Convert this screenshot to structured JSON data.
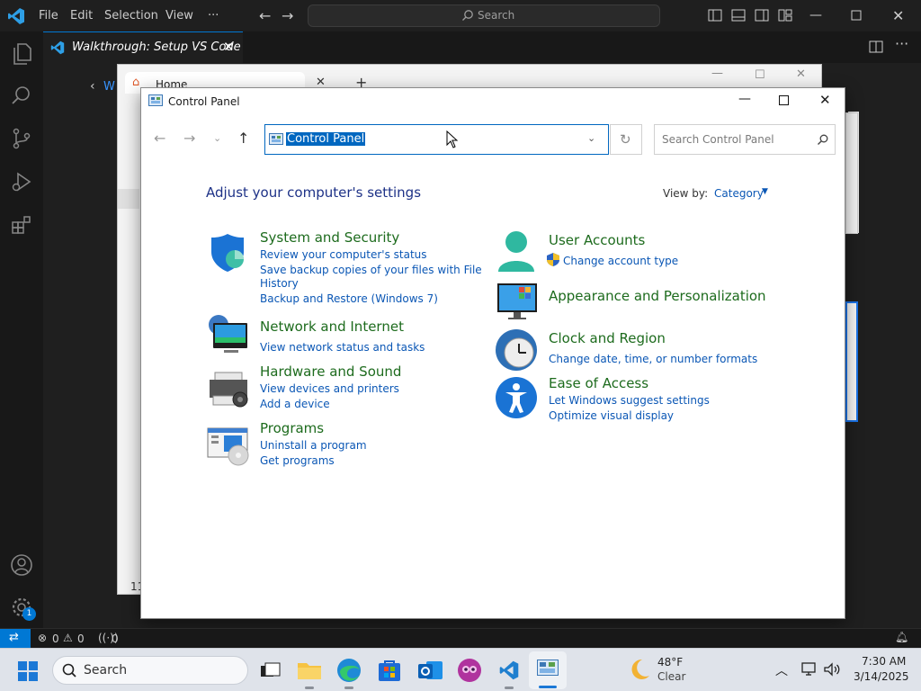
{
  "vscode": {
    "menu": [
      "File",
      "Edit",
      "Selection",
      "View",
      "···"
    ],
    "command_center_placeholder": "Search",
    "tab_title": "Walkthrough: Setup VS Code",
    "back_label": "W",
    "status": {
      "errors": "0",
      "warnings": "0",
      "ports": "0"
    },
    "accounts_badge": "1",
    "bg_side_text": "11"
  },
  "browser": {
    "tab_title": "Home",
    "new_tab": "+"
  },
  "control_panel": {
    "window_title": "Control Panel",
    "address_text": "Control Panel",
    "search_placeholder": "Search Control Panel",
    "heading": "Adjust your computer's settings",
    "view_by_label": "View by:",
    "view_by_value": "Category",
    "categories_left": [
      {
        "title": "System and Security",
        "links": [
          "Review your computer's status",
          "Save backup copies of your files with File",
          "History",
          "Backup and Restore (Windows 7)"
        ]
      },
      {
        "title": "Network and Internet",
        "links": [
          "View network status and tasks"
        ]
      },
      {
        "title": "Hardware and Sound",
        "links": [
          "View devices and printers",
          "Add a device"
        ]
      },
      {
        "title": "Programs",
        "links": [
          "Uninstall a program",
          "Get programs"
        ]
      }
    ],
    "categories_right": [
      {
        "title": "User Accounts",
        "links": [
          "Change account type"
        ]
      },
      {
        "title": "Appearance and Personalization",
        "links": []
      },
      {
        "title": "Clock and Region",
        "links": [
          "Change date, time, or number formats"
        ]
      },
      {
        "title": "Ease of Access",
        "links": [
          "Let Windows suggest settings",
          "Optimize visual display"
        ]
      }
    ]
  },
  "taskbar": {
    "search_placeholder": "Search",
    "weather_temp": "48°F",
    "weather_desc": "Clear",
    "time": "7:30 AM",
    "date": "3/14/2025"
  },
  "colors": {
    "vscode_blue": "#0078d4",
    "category_green": "#1d6b1d",
    "link_blue": "#0b57b5",
    "selection_blue": "#0067c0"
  }
}
